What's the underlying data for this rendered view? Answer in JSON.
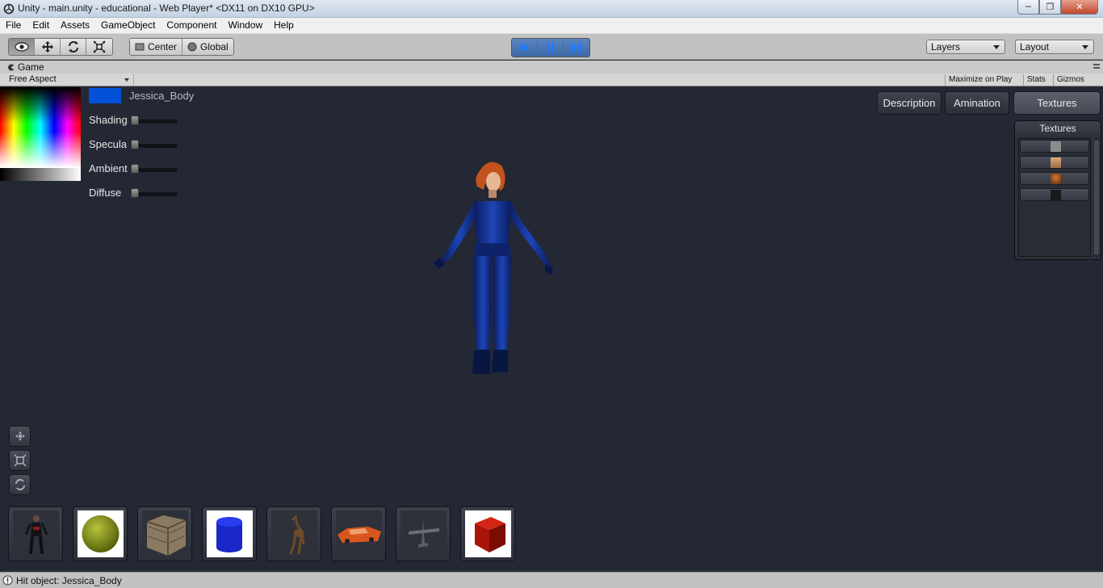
{
  "window": {
    "title": "Unity - main.unity - educational - Web Player* <DX11 on DX10 GPU>",
    "minimize_icon": "minimize-icon",
    "maximize_icon": "maximize-icon",
    "close_icon": "close-icon"
  },
  "menu": [
    "File",
    "Edit",
    "Assets",
    "GameObject",
    "Component",
    "Window",
    "Help"
  ],
  "toolbar": {
    "tools": [
      "eye-icon",
      "move-icon",
      "rotate-icon",
      "scale-icon"
    ],
    "pivot_center": "Center",
    "pivot_global": "Global",
    "layers": "Layers",
    "layout": "Layout"
  },
  "game_panel": {
    "tab": "Game",
    "aspect": "Free Aspect",
    "maximize_on_play": "Maximize on Play",
    "stats": "Stats",
    "gizmos": "Gizmos"
  },
  "viewport": {
    "object_name": "Jessica_Body",
    "swatch_color": "#0050d8",
    "sliders": [
      {
        "label": "Shading",
        "value": 0
      },
      {
        "label": "Specula",
        "value": 0
      },
      {
        "label": "Ambient",
        "value": 0
      },
      {
        "label": "Diffuse",
        "value": 0
      }
    ],
    "tabs": {
      "description": "Description",
      "animation": "Amination",
      "textures": "Textures",
      "selected": "Textures"
    },
    "textures_panel": {
      "title": "Textures",
      "items": [
        "grey-texture",
        "skin-texture",
        "hair-texture",
        "dark-texture"
      ]
    },
    "camera_buttons": [
      "pan-icon",
      "zoom-icon",
      "orbit-icon"
    ],
    "models": [
      "soldier-model",
      "green-sphere",
      "wooden-crate",
      "blue-cylinder",
      "deer-model",
      "orange-car",
      "airplane-model",
      "red-cube"
    ]
  },
  "status": {
    "text": "Hit object: Jessica_Body"
  }
}
